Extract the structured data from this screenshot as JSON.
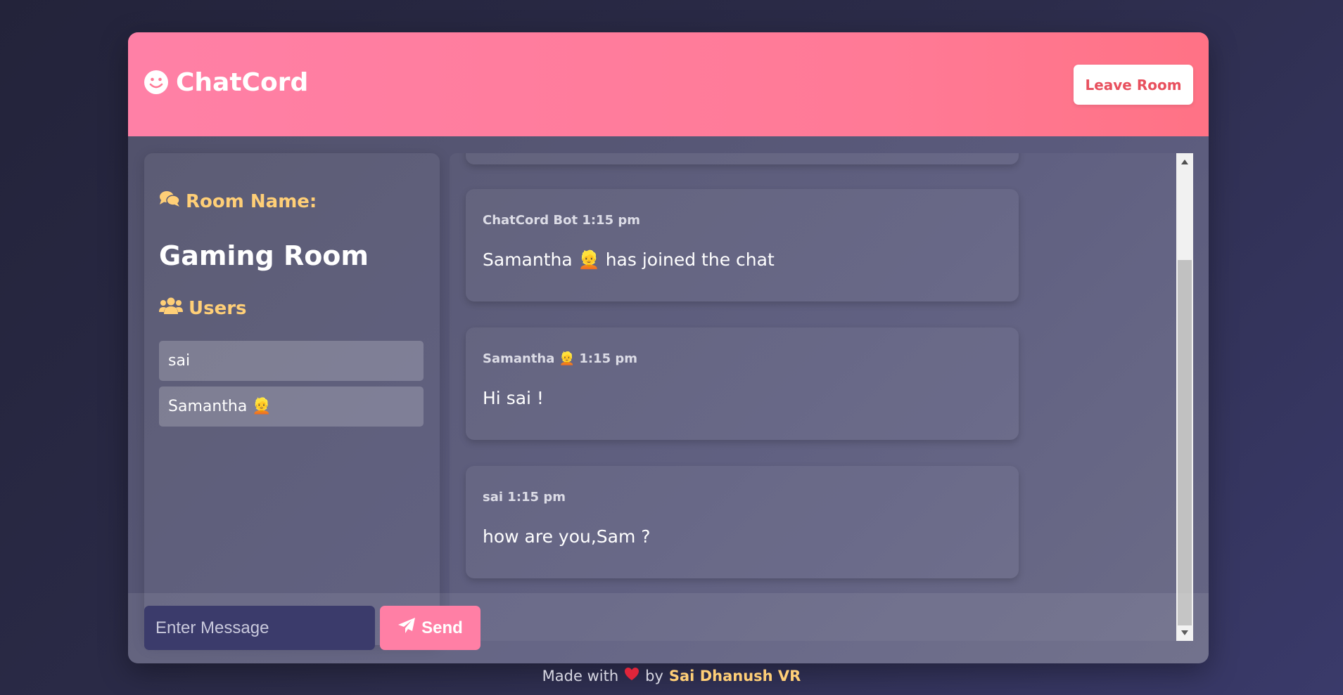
{
  "header": {
    "app_name": "ChatCord",
    "leave_label": "Leave Room"
  },
  "sidebar": {
    "room_heading": "Room Name:",
    "room_name": "Gaming Room",
    "users_heading": "Users",
    "users": [
      "sai",
      "Samantha 👱"
    ]
  },
  "messages": [
    {
      "meta": "ChatCord Bot 1:15 pm",
      "text": "Samantha 👱 has joined the chat"
    },
    {
      "meta": "Samantha 👱 1:15 pm",
      "text": "Hi sai !"
    },
    {
      "meta": "sai 1:15 pm",
      "text": "how are you,Sam ?"
    }
  ],
  "composer": {
    "placeholder": "Enter Message",
    "send_label": "Send"
  },
  "footer": {
    "made_with": "Made with",
    "by": "by",
    "author": "Sai Dhanush VR"
  },
  "colors": {
    "header_pink": "#ff7a96",
    "accent_yellow": "#ffcf77",
    "send_pink": "#ff7fa5",
    "input_bg": "#3b3b6b"
  },
  "icons": {
    "logo": "smile-icon",
    "room": "comments-icon",
    "users": "users-icon",
    "send": "paper-plane-icon",
    "heart": "heart-icon"
  }
}
